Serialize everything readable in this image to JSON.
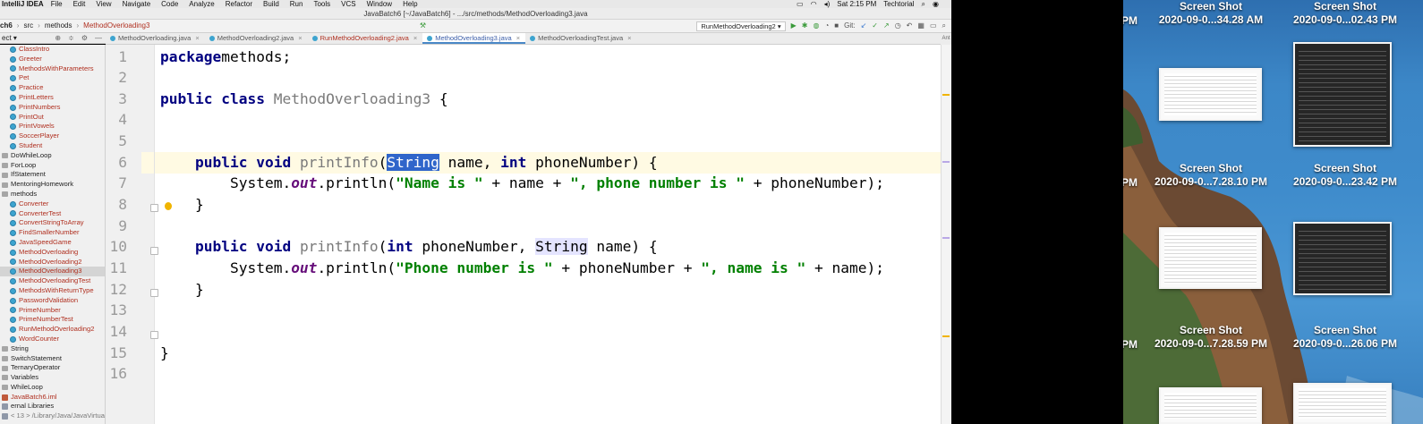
{
  "menubar": {
    "app_name": "IntelliJ IDEA",
    "menus": [
      "File",
      "Edit",
      "View",
      "Navigate",
      "Code",
      "Analyze",
      "Refactor",
      "Build",
      "Run",
      "Tools",
      "VCS",
      "Window",
      "Help"
    ],
    "clock": "Sat 2:15 PM",
    "user": "Techtorial"
  },
  "window_title": "JavaBatch6 [~/JavaBatch6] - .../src/methods/MethodOverloading3.java",
  "navbar": {
    "crumbs": [
      "ch6",
      "src",
      "methods",
      "MethodOverloading3"
    ],
    "run_config": "RunMethodOverloading2",
    "git_label": "Git:"
  },
  "project_panel": {
    "label": "ect"
  },
  "tabs": [
    {
      "label": "MethodOverloading.java",
      "active": false
    },
    {
      "label": "MethodOverloading2.java",
      "active": false
    },
    {
      "label": "RunMethodOverloading2.java",
      "active": false
    },
    {
      "label": "MethodOverloading3.java",
      "active": true
    },
    {
      "label": "MethodOverloadingTest.java",
      "active": false
    }
  ],
  "tree": [
    {
      "label": "ClassIntro",
      "kind": "class",
      "indent": 1,
      "color": "red"
    },
    {
      "label": "Greeter",
      "kind": "class",
      "indent": 1,
      "color": "red"
    },
    {
      "label": "MethodsWithParameters",
      "kind": "class",
      "indent": 1,
      "color": "red"
    },
    {
      "label": "Pet",
      "kind": "class",
      "indent": 1,
      "color": "red"
    },
    {
      "label": "Practice",
      "kind": "class",
      "indent": 1,
      "color": "red"
    },
    {
      "label": "PrintLetters",
      "kind": "class",
      "indent": 1,
      "color": "red"
    },
    {
      "label": "PrintNumbers",
      "kind": "class",
      "indent": 1,
      "color": "red"
    },
    {
      "label": "PrintOut",
      "kind": "class",
      "indent": 1,
      "color": "red"
    },
    {
      "label": "PrintVowels",
      "kind": "class",
      "indent": 1,
      "color": "red"
    },
    {
      "label": "SoccerPlayer",
      "kind": "class",
      "indent": 1,
      "color": "red"
    },
    {
      "label": "Student",
      "kind": "class",
      "indent": 1,
      "color": "red"
    },
    {
      "label": "DoWhileLoop",
      "kind": "folder",
      "indent": 0,
      "color": "dark"
    },
    {
      "label": "ForLoop",
      "kind": "folder",
      "indent": 0,
      "color": "dark"
    },
    {
      "label": "IfStatement",
      "kind": "folder",
      "indent": 0,
      "color": "dark"
    },
    {
      "label": "MentoringHomework",
      "kind": "folder",
      "indent": 0,
      "color": "dark"
    },
    {
      "label": "methods",
      "kind": "folder",
      "indent": 0,
      "color": "dark"
    },
    {
      "label": "Converter",
      "kind": "class",
      "indent": 1,
      "color": "red"
    },
    {
      "label": "ConverterTest",
      "kind": "class",
      "indent": 1,
      "color": "red"
    },
    {
      "label": "ConvertStringToArray",
      "kind": "class",
      "indent": 1,
      "color": "red"
    },
    {
      "label": "FindSmallerNumber",
      "kind": "class",
      "indent": 1,
      "color": "red"
    },
    {
      "label": "JavaSpeedGame",
      "kind": "class",
      "indent": 1,
      "color": "red"
    },
    {
      "label": "MethodOverloading",
      "kind": "class",
      "indent": 1,
      "color": "red"
    },
    {
      "label": "MethodOverloading2",
      "kind": "class",
      "indent": 1,
      "color": "red"
    },
    {
      "label": "MethodOverloading3",
      "kind": "class",
      "indent": 1,
      "color": "red",
      "selected": true
    },
    {
      "label": "MethodOverloadingTest",
      "kind": "class",
      "indent": 1,
      "color": "red"
    },
    {
      "label": "MethodsWithReturnType",
      "kind": "class",
      "indent": 1,
      "color": "red"
    },
    {
      "label": "PasswordValidation",
      "kind": "class",
      "indent": 1,
      "color": "red"
    },
    {
      "label": "PrimeNumber",
      "kind": "class",
      "indent": 1,
      "color": "red"
    },
    {
      "label": "PrimeNumberTest",
      "kind": "class",
      "indent": 1,
      "color": "red"
    },
    {
      "label": "RunMethodOverloading2",
      "kind": "class",
      "indent": 1,
      "color": "red"
    },
    {
      "label": "WordCounter",
      "kind": "class",
      "indent": 1,
      "color": "red"
    },
    {
      "label": "String",
      "kind": "folder",
      "indent": 0,
      "color": "dark"
    },
    {
      "label": "SwitchStatement",
      "kind": "folder",
      "indent": 0,
      "color": "dark"
    },
    {
      "label": "TernaryOperator",
      "kind": "folder",
      "indent": 0,
      "color": "dark"
    },
    {
      "label": "Variables",
      "kind": "folder",
      "indent": 0,
      "color": "dark"
    },
    {
      "label": "WhileLoop",
      "kind": "folder",
      "indent": 0,
      "color": "dark"
    },
    {
      "label": "JavaBatch6.iml",
      "kind": "file",
      "indent": 0,
      "color": "red"
    },
    {
      "label": "ernal Libraries",
      "kind": "lib",
      "indent": 0,
      "color": "dark"
    },
    {
      "label": "< 13 > /Library/Java/JavaVirtualM",
      "kind": "lib",
      "indent": 0,
      "color": "gray"
    }
  ],
  "editor": {
    "current_line": 6,
    "lines": [
      {
        "n": 1,
        "segs": [
          [
            "kw",
            "package"
          ],
          [
            "",
            "methods;"
          ]
        ]
      },
      {
        "n": 2,
        "segs": []
      },
      {
        "n": 3,
        "segs": [
          [
            "kw",
            "public class "
          ],
          [
            "fn",
            "MethodOverloading3"
          ],
          [
            "",
            " {"
          ]
        ]
      },
      {
        "n": 4,
        "segs": []
      },
      {
        "n": 5,
        "segs": []
      },
      {
        "n": 6,
        "segs": [
          [
            "",
            "    "
          ],
          [
            "kw",
            "public void "
          ],
          [
            "fn",
            "printInfo"
          ],
          [
            "",
            "("
          ],
          [
            "hl",
            "String"
          ],
          [
            "",
            " name, "
          ],
          [
            "kw",
            "int"
          ],
          [
            "",
            " phoneNumber) {"
          ]
        ]
      },
      {
        "n": 7,
        "segs": [
          [
            "",
            "        System."
          ],
          [
            "stat",
            "out"
          ],
          [
            "",
            ".println("
          ],
          [
            "str",
            "\"Name is \""
          ],
          [
            "",
            " + name + "
          ],
          [
            "str",
            "\", phone number is \""
          ],
          [
            "",
            " + phoneNumber);"
          ]
        ]
      },
      {
        "n": 8,
        "segs": [
          [
            "",
            "    }"
          ]
        ]
      },
      {
        "n": 9,
        "segs": []
      },
      {
        "n": 10,
        "segs": [
          [
            "",
            "    "
          ],
          [
            "kw",
            "public void "
          ],
          [
            "fn",
            "printInfo"
          ],
          [
            "",
            "("
          ],
          [
            "kw",
            "int"
          ],
          [
            "",
            " phoneNumber, "
          ],
          [
            "hl2",
            "String"
          ],
          [
            "",
            " name) {"
          ]
        ]
      },
      {
        "n": 11,
        "segs": [
          [
            "",
            "        System."
          ],
          [
            "stat",
            "out"
          ],
          [
            "",
            ".println("
          ],
          [
            "str",
            "\"Phone number is \""
          ],
          [
            "",
            " + phoneNumber + "
          ],
          [
            "str",
            "\", name is \""
          ],
          [
            "",
            " + name);"
          ]
        ]
      },
      {
        "n": 12,
        "segs": [
          [
            "",
            "    }"
          ]
        ]
      },
      {
        "n": 13,
        "segs": []
      },
      {
        "n": 14,
        "segs": []
      },
      {
        "n": 15,
        "segs": [
          [
            "",
            "}"
          ]
        ]
      },
      {
        "n": 16,
        "segs": []
      }
    ]
  },
  "side_strip_label": "Ant",
  "desktop": {
    "items": [
      {
        "l1": "Screen Shot",
        "l2": "2020-09-0...34.28 AM"
      },
      {
        "l1": "Screen Shot",
        "l2": "2020-09-0...02.43 PM"
      },
      {
        "l1": "Screen Shot",
        "l2": "2020-09-0...7.28.10 PM"
      },
      {
        "l1": "Screen Shot",
        "l2": "2020-09-0...23.42 PM"
      },
      {
        "l1": "Screen Shot",
        "l2": "2020-09-0...7.28.59 PM"
      },
      {
        "l1": "Screen Shot",
        "l2": "2020-09-0...26.06 PM"
      }
    ],
    "partial_labels": [
      "PM",
      "PM",
      "PM"
    ]
  },
  "colors": {
    "keyword": "#000080",
    "string": "#008000",
    "selection": "#2f65ca",
    "tree_red": "#b03020",
    "current_line": "#fffae3"
  }
}
